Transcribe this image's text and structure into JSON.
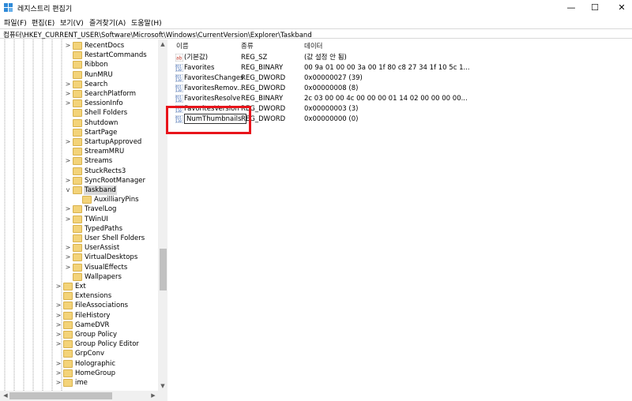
{
  "window": {
    "title": "레지스트리 편집기",
    "minimize": "—",
    "maximize": "☐",
    "close": "✕"
  },
  "menu": [
    "파일(F)",
    "편집(E)",
    "보기(V)",
    "즐겨찾기(A)",
    "도움말(H)"
  ],
  "address": "컴퓨터\\HKEY_CURRENT_USER\\Software\\Microsoft\\Windows\\CurrentVersion\\Explorer\\Taskband",
  "tree": [
    {
      "label": "RecentDocs",
      "expander": ">",
      "level": 3
    },
    {
      "label": "RestartCommands",
      "expander": "",
      "level": 3
    },
    {
      "label": "Ribbon",
      "expander": "",
      "level": 3
    },
    {
      "label": "RunMRU",
      "expander": "",
      "level": 3
    },
    {
      "label": "Search",
      "expander": ">",
      "level": 3
    },
    {
      "label": "SearchPlatform",
      "expander": ">",
      "level": 3
    },
    {
      "label": "SessionInfo",
      "expander": ">",
      "level": 3
    },
    {
      "label": "Shell Folders",
      "expander": "",
      "level": 3
    },
    {
      "label": "Shutdown",
      "expander": "",
      "level": 3
    },
    {
      "label": "StartPage",
      "expander": "",
      "level": 3
    },
    {
      "label": "StartupApproved",
      "expander": ">",
      "level": 3
    },
    {
      "label": "StreamMRU",
      "expander": "",
      "level": 3
    },
    {
      "label": "Streams",
      "expander": ">",
      "level": 3
    },
    {
      "label": "StuckRects3",
      "expander": "",
      "level": 3
    },
    {
      "label": "SyncRootManager",
      "expander": ">",
      "level": 3
    },
    {
      "label": "Taskband",
      "expander": "v",
      "level": 3,
      "selected": true
    },
    {
      "label": "AuxilliaryPins",
      "expander": "",
      "level": 4
    },
    {
      "label": "TravelLog",
      "expander": ">",
      "level": 3
    },
    {
      "label": "TWinUI",
      "expander": ">",
      "level": 3
    },
    {
      "label": "TypedPaths",
      "expander": "",
      "level": 3
    },
    {
      "label": "User Shell Folders",
      "expander": "",
      "level": 3
    },
    {
      "label": "UserAssist",
      "expander": ">",
      "level": 3
    },
    {
      "label": "VirtualDesktops",
      "expander": ">",
      "level": 3
    },
    {
      "label": "VisualEffects",
      "expander": ">",
      "level": 3
    },
    {
      "label": "Wallpapers",
      "expander": "",
      "level": 3
    },
    {
      "label": "Ext",
      "expander": ">",
      "level": 2
    },
    {
      "label": "Extensions",
      "expander": "",
      "level": 2
    },
    {
      "label": "FileAssociations",
      "expander": ">",
      "level": 2
    },
    {
      "label": "FileHistory",
      "expander": ">",
      "level": 2
    },
    {
      "label": "GameDVR",
      "expander": ">",
      "level": 2
    },
    {
      "label": "Group Policy",
      "expander": ">",
      "level": 2
    },
    {
      "label": "Group Policy Editor",
      "expander": ">",
      "level": 2
    },
    {
      "label": "GrpConv",
      "expander": "",
      "level": 2
    },
    {
      "label": "Holographic",
      "expander": ">",
      "level": 2
    },
    {
      "label": "HomeGroup",
      "expander": ">",
      "level": 2
    },
    {
      "label": "ime",
      "expander": ">",
      "level": 2
    }
  ],
  "columns": {
    "name": "이름",
    "type": "종류",
    "data": "데이터"
  },
  "values": [
    {
      "icon": "string-value-icon",
      "name": "(기본값)",
      "type": "REG_SZ",
      "data": "(값 설정 안 됨)"
    },
    {
      "icon": "binary-value-icon",
      "name": "Favorites",
      "type": "REG_BINARY",
      "data": "00 9a 01 00 00 3a 00 1f 80 c8 27 34 1f 10 5c 1..."
    },
    {
      "icon": "binary-value-icon",
      "name": "FavoritesChanges",
      "type": "REG_DWORD",
      "data": "0x00000027 (39)"
    },
    {
      "icon": "binary-value-icon",
      "name": "FavoritesRemov...",
      "type": "REG_DWORD",
      "data": "0x00000008 (8)"
    },
    {
      "icon": "binary-value-icon",
      "name": "FavoritesResolve",
      "type": "REG_BINARY",
      "data": "2c 03 00 00 4c 00 00 00 01 14 02 00 00 00 00..."
    },
    {
      "icon": "binary-value-icon",
      "name": "FavoritesVersion",
      "type": "REG_DWORD",
      "data": "0x00000003 (3)"
    },
    {
      "icon": "binary-value-icon",
      "name": "NumThumbnails",
      "type": "REG_DWORD",
      "data": "0x00000000 (0)",
      "editing": true
    }
  ],
  "colors": {
    "highlight": "#e8141b",
    "selection": "#d9d9d9",
    "folder": "#f3d379"
  }
}
